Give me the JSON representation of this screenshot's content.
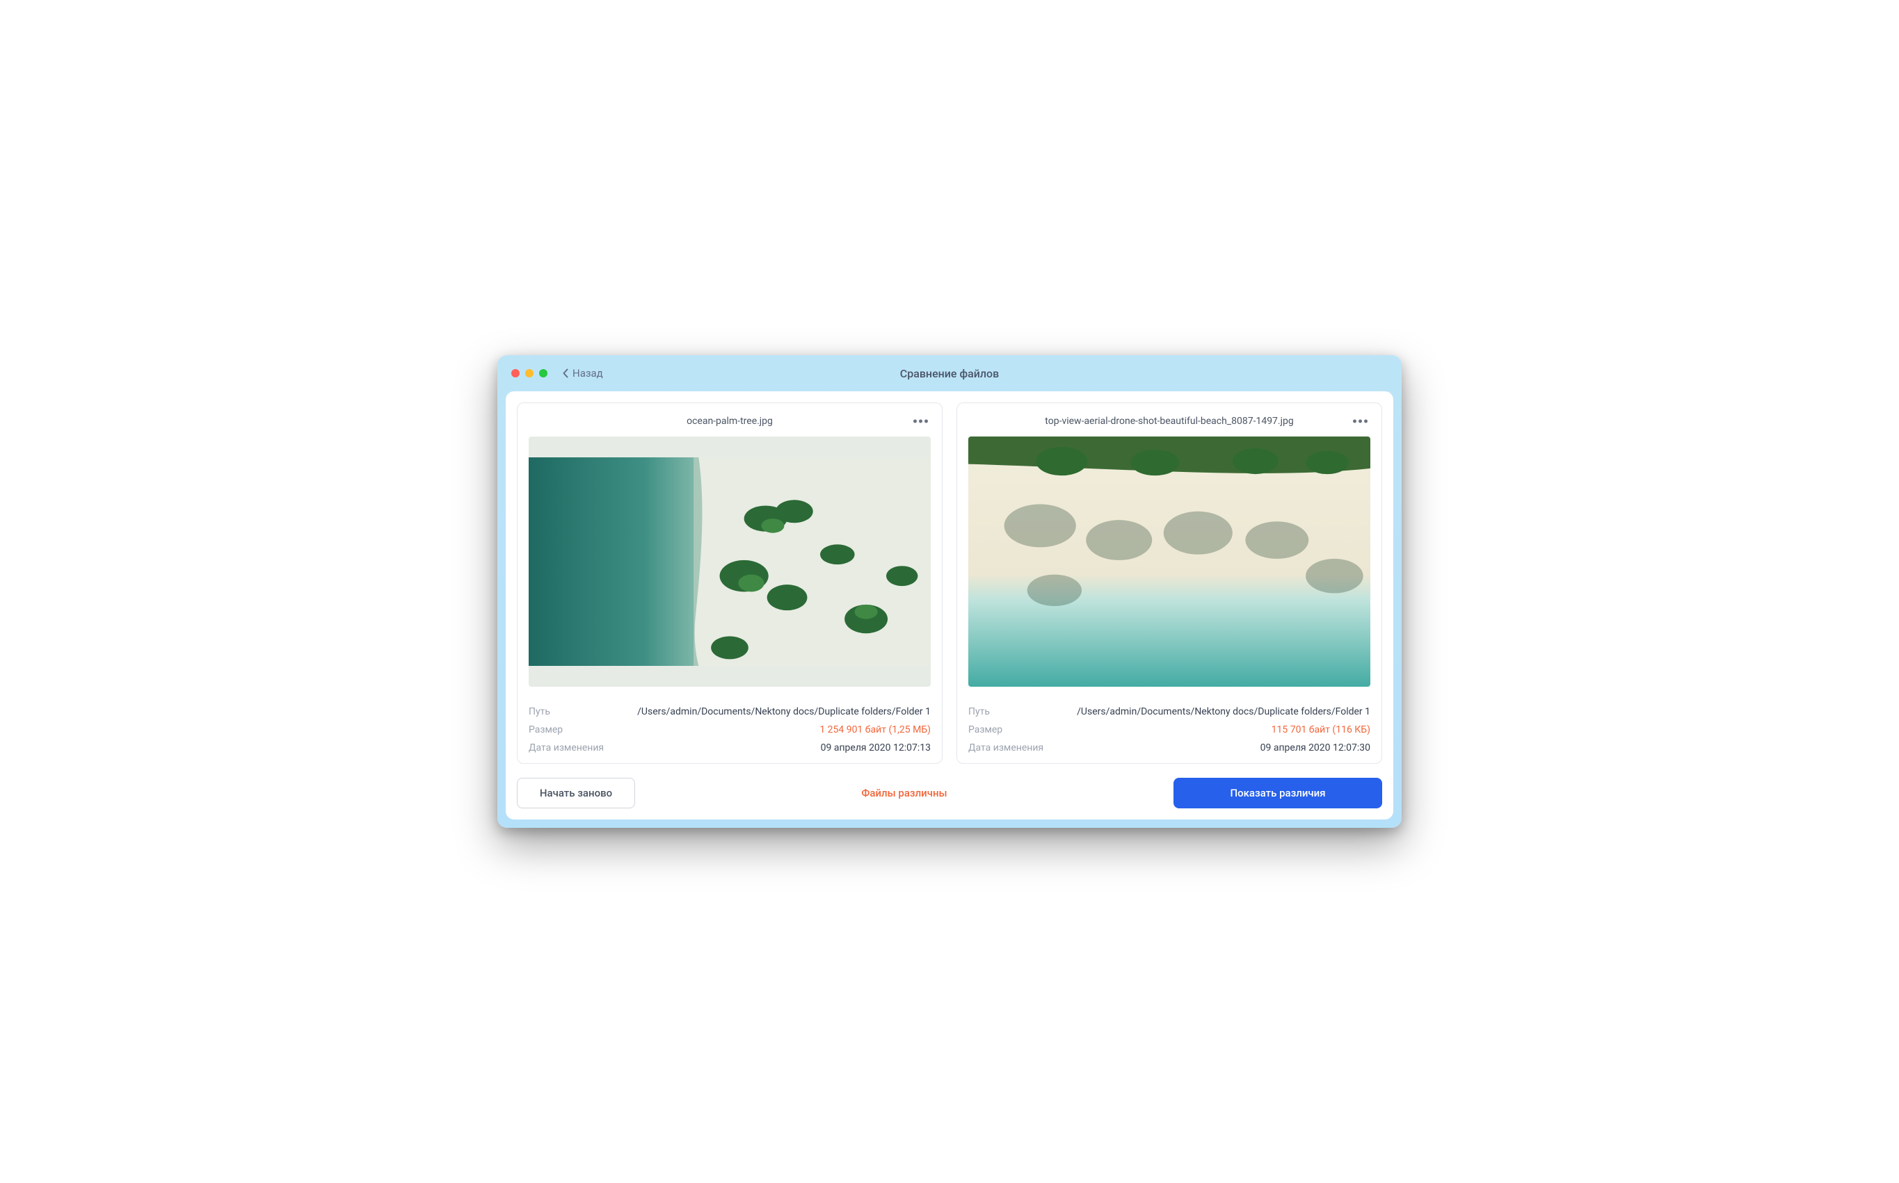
{
  "window": {
    "title": "Сравнение файлов",
    "back_label": "Назад"
  },
  "files": [
    {
      "name": "ocean-palm-tree.jpg",
      "path": "/Users/admin/Documents/Nektony docs/Duplicate folders/Folder 1",
      "size": "1 254 901 байт (1,25 МБ)",
      "modified": "09 апреля 2020 12:07:13"
    },
    {
      "name": "top-view-aerial-drone-shot-beautiful-beach_8087-1497.jpg",
      "path": "/Users/admin/Documents/Nektony docs/Duplicate folders/Folder 1",
      "size": "115 701 байт (116 КБ)",
      "modified": "09 апреля 2020 12:07:30"
    }
  ],
  "labels": {
    "path": "Путь",
    "size": "Размер",
    "modified": "Дата изменения"
  },
  "footer": {
    "restart": "Начать заново",
    "status": "Файлы различны",
    "show_diff": "Показать различия"
  },
  "colors": {
    "accent_orange": "#F2663B",
    "accent_blue": "#2660EB",
    "window_bg_top": "#BCE4F7",
    "window_bg_bottom": "#B5E0F9"
  }
}
